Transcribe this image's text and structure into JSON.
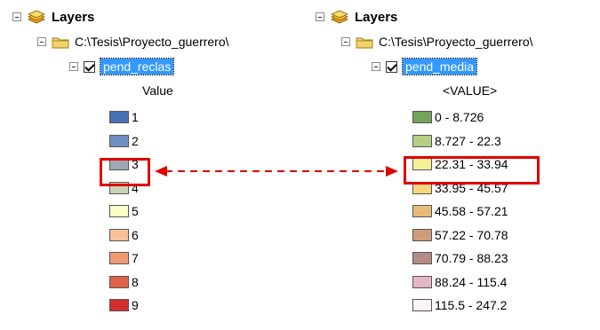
{
  "left_panel": {
    "root_label": "Layers",
    "folder_path": "C:\\Tesis\\Proyecto_guerrero\\",
    "layer_name": "pend_reclas",
    "field_header": "Value",
    "classes": [
      {
        "label": "1",
        "color": "#4472b4"
      },
      {
        "label": "2",
        "color": "#6f8fc4"
      },
      {
        "label": "3",
        "color": "#9daab5"
      },
      {
        "label": "4",
        "color": "#c8d3b8"
      },
      {
        "label": "5",
        "color": "#fdfdc8"
      },
      {
        "label": "6",
        "color": "#f8c196"
      },
      {
        "label": "7",
        "color": "#f09a72"
      },
      {
        "label": "8",
        "color": "#e06248"
      },
      {
        "label": "9",
        "color": "#d42f2f"
      }
    ]
  },
  "right_panel": {
    "root_label": "Layers",
    "folder_path": "C:\\Tesis\\Proyecto_guerrero\\",
    "layer_name": "pend_media",
    "field_header": "<VALUE>",
    "classes": [
      {
        "label": "0 - 8.726",
        "color": "#74a35a"
      },
      {
        "label": "8.727 - 22.3",
        "color": "#b6cf84"
      },
      {
        "label": "22.31 - 33.94",
        "color": "#f6f09a"
      },
      {
        "label": "33.95 - 45.57",
        "color": "#f5d681"
      },
      {
        "label": "45.58 - 57.21",
        "color": "#e8bc78"
      },
      {
        "label": "57.22 - 70.78",
        "color": "#cf9c7a"
      },
      {
        "label": "70.79 - 88.23",
        "color": "#b78a86"
      },
      {
        "label": "88.24 - 115.4",
        "color": "#e6b6c8"
      },
      {
        "label": "115.5 - 247.2",
        "color": "#fbf4f7"
      }
    ]
  },
  "annotation": {
    "highlight_color": "#e00000",
    "left_highlighted_class": "3",
    "right_highlighted_class": "22.31 - 33.94"
  }
}
